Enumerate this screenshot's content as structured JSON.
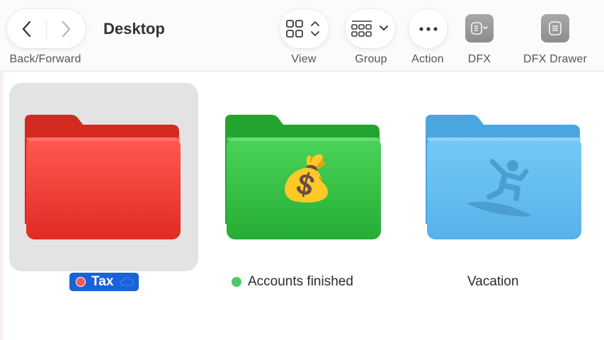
{
  "window": {
    "title": "Desktop"
  },
  "toolbar": {
    "nav_label": "Back/Forward",
    "view_label": "View",
    "group_label": "Group",
    "action_label": "Action",
    "dfx_label": "DFX",
    "dfx_drawer_label": "DFX Drawer"
  },
  "files": [
    {
      "name": "Tax",
      "tag": "red",
      "tag_color": "#f05a5a",
      "folder_color": "#e8322e",
      "selected": true,
      "icloud": true
    },
    {
      "name": "Accounts finished",
      "tag": "green",
      "tag_color": "#4ec96a",
      "folder_color": "#2fb640",
      "emoji": "💰",
      "selected": false
    },
    {
      "name": "Vacation",
      "folder_color": "#5cb6ec",
      "symbol": "surfer-icon",
      "selected": false
    }
  ],
  "colors": {
    "selection": "#1a62d9",
    "selection_bg": "#e3e3e3"
  }
}
